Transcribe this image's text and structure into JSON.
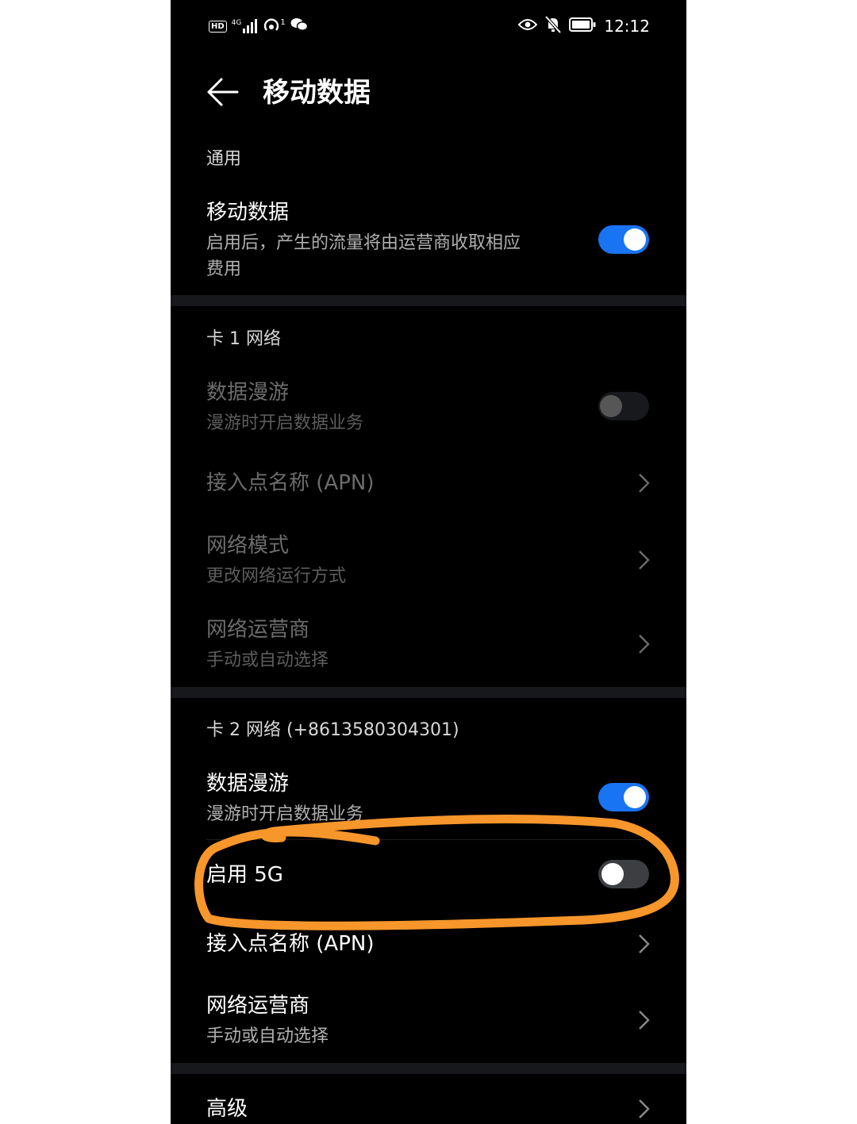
{
  "status_bar": {
    "network_badge": "HD",
    "signal_type": "4G",
    "hotspot_sup": "1",
    "time": "12:12",
    "icons": [
      "hd-icon",
      "signal-icon",
      "hotspot-icon",
      "wechat-icon",
      "eye-icon",
      "bell-muted-icon",
      "battery-icon"
    ]
  },
  "header": {
    "title": "移动数据"
  },
  "general": {
    "label": "通用",
    "mobile_data": {
      "title": "移动数据",
      "desc_line1": "启用后，产生的流量将由运营商收取相应",
      "desc_line2": "费用",
      "enabled": true
    }
  },
  "sim1": {
    "label": "卡 1 网络",
    "roaming": {
      "title": "数据漫游",
      "desc": "漫游时开启数据业务",
      "enabled": false
    },
    "apn": {
      "title": "接入点名称 (APN)"
    },
    "network_mode": {
      "title": "网络模式",
      "desc": "更改网络运行方式"
    },
    "carrier": {
      "title": "网络运营商",
      "desc": "手动或自动选择"
    }
  },
  "sim2": {
    "label": "卡 2 网络 (+8613580304301)",
    "roaming": {
      "title": "数据漫游",
      "desc": "漫游时开启数据业务",
      "enabled": true
    },
    "enable_5g": {
      "title": "启用 5G",
      "enabled": false
    },
    "apn": {
      "title": "接入点名称 (APN)"
    },
    "carrier": {
      "title": "网络运营商",
      "desc": "手动或自动选择"
    }
  },
  "advanced": {
    "title": "高级"
  },
  "colors": {
    "background": "#000000",
    "accent": "#1874f2",
    "annotation": "#f7962b"
  }
}
